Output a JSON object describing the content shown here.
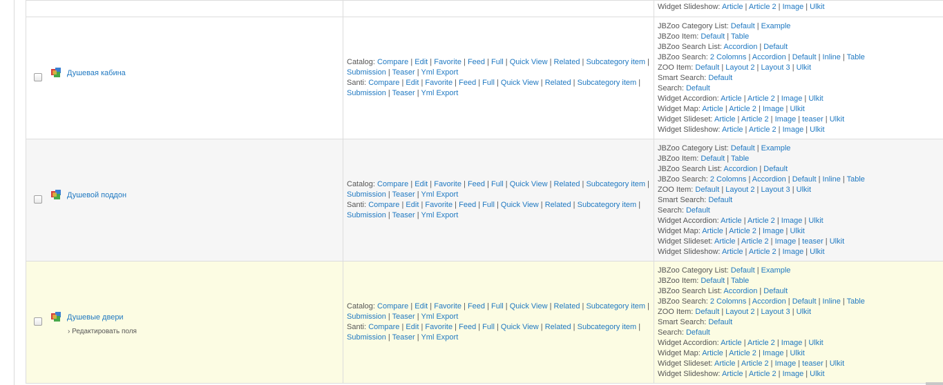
{
  "catalog_prefix": "Catalog:",
  "santi_prefix": "Santi:",
  "layout_links": {
    "catalog_line1": [
      "Compare",
      "Edit",
      "Favorite",
      "Feed",
      "Full",
      "Quick View",
      "Related",
      "Subcategory item"
    ],
    "catalog_line2": [
      "Submission",
      "Teaser",
      "Yml Export"
    ],
    "santi_line1": [
      "Compare",
      "Edit",
      "Favorite",
      "Feed",
      "Full",
      "Quick View",
      "Related",
      "Subcategory item"
    ],
    "santi_line2": [
      "Submission",
      "Teaser",
      "Yml Export"
    ]
  },
  "modules": [
    {
      "label": "JBZoo Category List:",
      "links": [
        "Default",
        "Example"
      ]
    },
    {
      "label": "JBZoo Item:",
      "links": [
        "Default",
        "Table"
      ]
    },
    {
      "label": "JBZoo Search List:",
      "links": [
        "Accordion",
        "Default"
      ]
    },
    {
      "label": "JBZoo Search:",
      "links": [
        "2 Colomns",
        "Accordion",
        "Default",
        "Inline",
        "Table"
      ]
    },
    {
      "label": "ZOO Item:",
      "links": [
        "Default",
        "Layout 2",
        "Layout 3",
        "Ulkit"
      ]
    },
    {
      "label": "Smart Search:",
      "links": [
        "Default"
      ]
    },
    {
      "label": "Search:",
      "links": [
        "Default"
      ]
    },
    {
      "label": "Widget Accordion:",
      "links": [
        "Article",
        "Article 2",
        "Image",
        "Ulkit"
      ]
    },
    {
      "label": "Widget Map:",
      "links": [
        "Article",
        "Article 2",
        "Image",
        "Ulkit"
      ]
    },
    {
      "label": "Widget Slideset:",
      "links": [
        "Article",
        "Article 2",
        "Image",
        "teaser",
        "Ulkit"
      ]
    },
    {
      "label": "Widget Slideshow:",
      "links": [
        "Article",
        "Article 2",
        "Image",
        "Ulkit"
      ]
    }
  ],
  "top_partial_row": {
    "label": "Widget Slideshow:",
    "links": [
      "Article",
      "Article 2",
      "Image",
      "Ulkit"
    ]
  },
  "rows": [
    {
      "title": "Душевая кабина",
      "style": "row-white",
      "edit_label": ""
    },
    {
      "title": "Душевой поддон",
      "style": "row-gray",
      "edit_label": ""
    },
    {
      "title": "Душевые двери",
      "style": "row-yellow",
      "edit_label": "› Редактировать поля"
    }
  ],
  "colors": {
    "link": "#1f78c1",
    "text": "#555555",
    "highlight_row": "#fcfce3",
    "alt_row": "#f6f6f6",
    "border": "#dcdcdc"
  },
  "icons": {
    "type_icon": "cube-icon",
    "checkbox": "checkbox"
  }
}
